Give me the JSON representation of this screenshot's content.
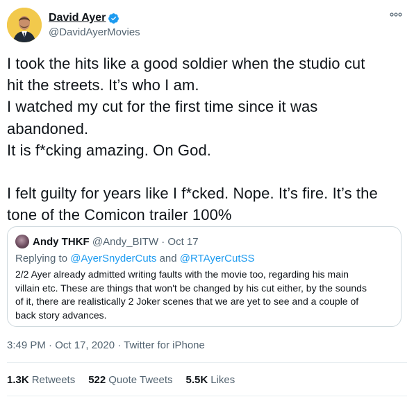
{
  "author": {
    "display_name": "David Ayer",
    "handle": "@DavidAyerMovies",
    "verified": true,
    "avatar_icon": "person-portrait-icon",
    "avatar_bg": "#f2c94c"
  },
  "tweet": {
    "lines": [
      "I took the hits like a good soldier when the studio cut",
      "hit the streets. It’s who I am.",
      "I watched my cut for the first time since it was",
      "abandoned.",
      "It is f*cking amazing. On God.",
      "",
      "I felt guilty for years like I f*cked. Nope. It’s fire. It’s the",
      "tone of the Comicon trailer 100%"
    ]
  },
  "quote": {
    "name": "Andy THKF",
    "handle_date": "@Andy_BITW · Oct 17",
    "reply_prefix": "Replying to",
    "reply_mention_1": "@AyerSnyderCuts",
    "reply_and": "and",
    "reply_mention_2": "@RTAyerCutSS",
    "lines": [
      "2/2 Ayer already admitted writing faults with the movie too, regarding his main",
      "villain etc. These are things that won't be changed by his cut either, by the sounds",
      "of it, there are realistically 2 Joker scenes that we are yet to see and a couple of",
      "back story advances."
    ]
  },
  "meta": {
    "timestamp": "3:49 PM · Oct 17, 2020 · Twitter for iPhone"
  },
  "stats": {
    "retweets_count": "1.3K",
    "retweets_label": "Retweets",
    "quotes_count": "522",
    "quotes_label": "Quote Tweets",
    "likes_count": "5.5K",
    "likes_label": "Likes"
  },
  "colors": {
    "accent": "#1d9bf0",
    "verified": "#1d9bf0",
    "secondary_text": "#536471",
    "border": "#cfd9de"
  }
}
